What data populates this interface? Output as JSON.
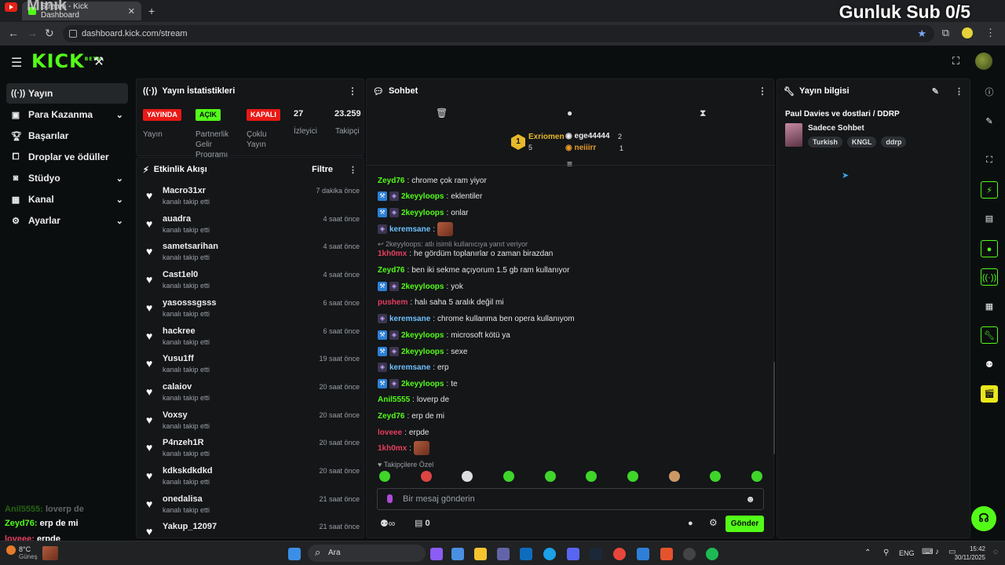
{
  "overlay": {
    "minik": "Minik",
    "sub_counter": "Gunluk Sub 0/5"
  },
  "browser": {
    "tab_title": "Stream - Kick Dashboard",
    "url": "dashboard.kick.com/stream"
  },
  "header": {
    "logo": "KICK",
    "logo_beta": "BETA"
  },
  "sidebar": {
    "items": [
      {
        "label": "Yayın",
        "icon": "broadcast-icon"
      },
      {
        "label": "Para Kazanma",
        "icon": "money-icon"
      },
      {
        "label": "Başarılar",
        "icon": "trophy-icon"
      },
      {
        "label": "Droplar ve ödüller",
        "icon": "gift-icon"
      },
      {
        "label": "Stüdyo",
        "icon": "studio-icon"
      },
      {
        "label": "Kanal",
        "icon": "channel-icon"
      },
      {
        "label": "Ayarlar",
        "icon": "gear-icon"
      }
    ],
    "overlay_chat": [
      {
        "user": "Anil5555",
        "text": "loverp de"
      },
      {
        "user": "Zeyd76",
        "text": "erp de mi"
      },
      {
        "user": "loveee",
        "text": "erpde"
      }
    ]
  },
  "stats": {
    "title": "Yayın İstatistikleri",
    "status_badge": "YAYINDA",
    "status_label": "Yayın",
    "partner_badge": "AÇIK",
    "partner_label_1": "Partnerlik",
    "partner_label_2": "Gelir",
    "partner_label_3": "Programı",
    "multi_badge": "KAPALI",
    "multi_label_1": "Çoklu",
    "multi_label_2": "Yayın",
    "viewers": "27",
    "viewers_label": "İzleyici",
    "followers": "23.259",
    "followers_label": "Takipçi"
  },
  "activity": {
    "title": "Etkinlik Akışı",
    "filter": "Filtre",
    "items": [
      {
        "user": "Macro31xr",
        "action": "kanalı takip etti",
        "time": "7 dakika önce"
      },
      {
        "user": "auadra",
        "action": "kanalı takip etti",
        "time": "4 saat önce"
      },
      {
        "user": "sametsarihan",
        "action": "kanalı takip etti",
        "time": "4 saat önce"
      },
      {
        "user": "Cast1el0",
        "action": "kanalı takip etti",
        "time": "4 saat önce"
      },
      {
        "user": "yasosssgsss",
        "action": "kanalı takip etti",
        "time": "6 saat önce"
      },
      {
        "user": "hackree",
        "action": "kanalı takip etti",
        "time": "6 saat önce"
      },
      {
        "user": "Yusu1ff",
        "action": "kanalı takip etti",
        "time": "19 saat önce"
      },
      {
        "user": "calaiov",
        "action": "kanalı takip etti",
        "time": "20 saat önce"
      },
      {
        "user": "Voxsy",
        "action": "kanalı takip etti",
        "time": "20 saat önce"
      },
      {
        "user": "P4nzeh1R",
        "action": "kanalı takip etti",
        "time": "20 saat önce"
      },
      {
        "user": "kdkskdkdkd",
        "action": "kanalı takip etti",
        "time": "20 saat önce"
      },
      {
        "user": "onedalisa",
        "action": "kanalı takip etti",
        "time": "21 saat önce"
      },
      {
        "user": "Yakup_12097",
        "action": "",
        "time": "21 saat önce"
      }
    ]
  },
  "chat": {
    "title": "Sohbet",
    "leader": {
      "rank": "1",
      "name": "Exriomen",
      "count": "5"
    },
    "gifters": [
      {
        "name": "ege44444",
        "count": "2"
      },
      {
        "name": "neiiirr",
        "count": "1"
      }
    ],
    "messages": [
      {
        "user": "Zeyd76",
        "color": "#53fc18",
        "badges": [],
        "text": "chrome çok ram yiyor"
      },
      {
        "user": "2keyyloops",
        "color": "#53fc18",
        "badges": [
          "hammer",
          "sub"
        ],
        "text": "eklentiler"
      },
      {
        "user": "2keyyloops",
        "color": "#53fc18",
        "badges": [
          "hammer",
          "sub"
        ],
        "text": "onlar"
      },
      {
        "user": "keremsane",
        "color": "#6ec1ff",
        "badges": [
          "sub"
        ],
        "text": "",
        "emote": true
      },
      {
        "reply": "2keyyloops: atlı isimli kullanıcıya yanıt veriyor"
      },
      {
        "user": "1kh0mx",
        "color": "#e53e5e",
        "badges": [],
        "text": "he gördüm toplanırlar o zaman birazdan"
      },
      {
        "user": "Zeyd76",
        "color": "#53fc18",
        "badges": [],
        "text": "ben iki sekme açıyorum 1.5 gb ram kullanıyor"
      },
      {
        "user": "2keyyloops",
        "color": "#53fc18",
        "badges": [
          "hammer",
          "sub"
        ],
        "text": "yok"
      },
      {
        "user": "pushem",
        "color": "#e53e5e",
        "badges": [],
        "text": "halı saha 5 aralık değil mi"
      },
      {
        "user": "keremsane",
        "color": "#6ec1ff",
        "badges": [
          "sub"
        ],
        "text": "chrome kullanma ben opera kullanıyom"
      },
      {
        "user": "2keyyloops",
        "color": "#53fc18",
        "badges": [
          "hammer",
          "sub"
        ],
        "text": "microsoft kötü ya"
      },
      {
        "user": "2keyyloops",
        "color": "#53fc18",
        "badges": [
          "hammer",
          "sub"
        ],
        "text": "sexe"
      },
      {
        "user": "keremsane",
        "color": "#6ec1ff",
        "badges": [
          "sub"
        ],
        "text": "erp"
      },
      {
        "user": "2keyyloops",
        "color": "#53fc18",
        "badges": [
          "hammer",
          "sub"
        ],
        "text": "te"
      },
      {
        "user": "Anil5555",
        "color": "#53fc18",
        "badges": [],
        "text": "loverp de"
      },
      {
        "user": "Zeyd76",
        "color": "#53fc18",
        "badges": [],
        "text": "erp de mi"
      },
      {
        "user": "loveee",
        "color": "#e53e5e",
        "badges": [],
        "text": "erpde"
      },
      {
        "user": "1kh0mx",
        "color": "#e53e5e",
        "badges": [],
        "text": "",
        "emote": true
      }
    ],
    "followers_only": "Takipçilere Özel",
    "input_placeholder": "Bir mesaj gönderin",
    "gifts_count": "0",
    "send": "Gönder"
  },
  "stream_info": {
    "title": "Yayın bilgisi",
    "stream_title": "Paul Davies ve dostlari / DDRP",
    "category": "Sadece Sohbet",
    "tags": [
      "Turkish",
      "KNGL",
      "ddrp"
    ]
  },
  "taskbar": {
    "weather": "8°C",
    "weather_sub": "Güneş",
    "search": "Ara",
    "lang": "ENG",
    "time": "15:42",
    "date": "30/11/2025"
  },
  "colors": {
    "accent": "#53fc18",
    "live_red": "#e91916",
    "panel": "#141618"
  }
}
